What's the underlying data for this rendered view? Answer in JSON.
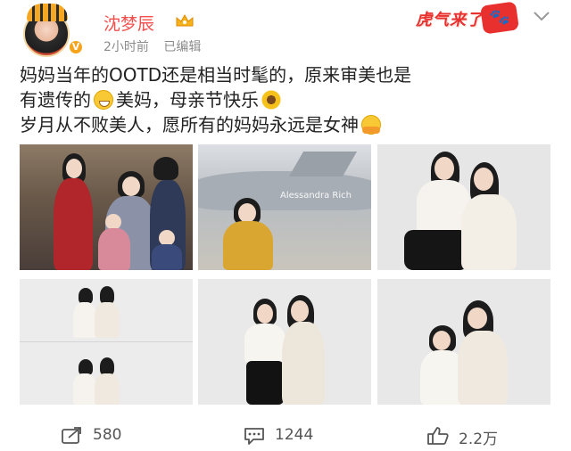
{
  "header": {
    "username": "沈梦辰",
    "time": "2小时前",
    "edited": "已编辑",
    "sticker_text": "虎气来了"
  },
  "post": {
    "line1": "妈妈当年的OOTD还是相当时髦的，原来审美也是",
    "line2a": "有遗传的",
    "line2b": "美妈，母亲节快乐",
    "line3": "岁月从不败美人，愿所有的妈妈永远是女神"
  },
  "images": [
    {
      "alt": "family-photo"
    },
    {
      "alt": "plane-photo",
      "watermark": "Alessandra Rich"
    },
    {
      "alt": "white-outfit-photo"
    },
    {
      "alt": "sunglasses-collage"
    },
    {
      "alt": "standing-duo-photo"
    },
    {
      "alt": "leaning-duo-photo"
    }
  ],
  "actions": {
    "reposts": "580",
    "comments": "1244",
    "likes": "2.2万"
  },
  "colors": {
    "username": "#f3504e",
    "meta": "#8c8c8c",
    "action": "#555555"
  }
}
